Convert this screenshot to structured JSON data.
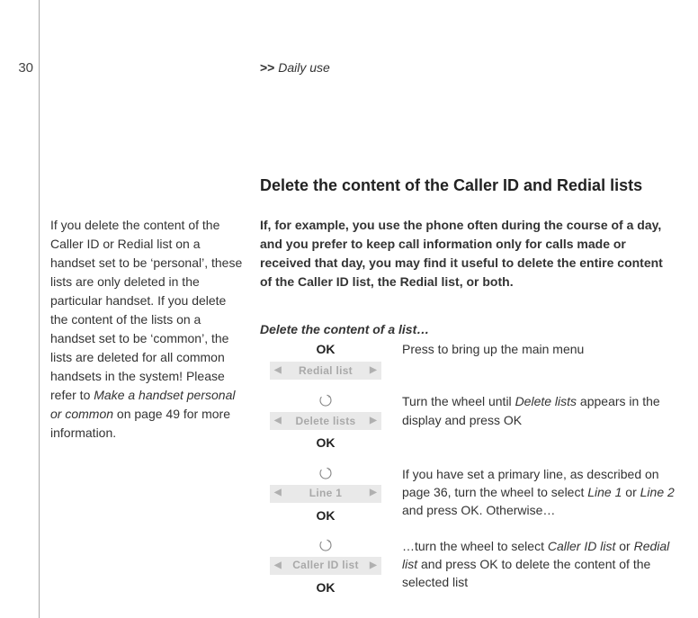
{
  "page_number": "30",
  "running_head": {
    "chev": ">>",
    "title": "Daily use"
  },
  "heading": "Delete the content of the Caller ID and Redial lists",
  "side_note": {
    "part1": "If you delete the content of the Caller ID or Redial list on a handset set to be ‘personal’, these lists are only deleted in the particular handset. If you delete the content of the lists on a handset set to be ‘common’, the lists are deleted for all common handsets in the system! Please refer to ",
    "em": "Make a handset personal or common",
    "part2": " on page 49 for more information."
  },
  "intro": "If, for example, you use the phone often during the course of a day, and you prefer to keep call information only for calls made or received that day, you may find it useful to delete the entire content of the Caller ID list, the Redial list, or both.",
  "subhead": "Delete the content of a list…",
  "ok_label": "OK",
  "steps": [
    {
      "buttons": [
        {
          "type": "ok"
        },
        {
          "type": "pill",
          "label": "Redial list"
        }
      ],
      "desc_parts": [
        {
          "t": "text",
          "v": "Press to bring up the main menu"
        }
      ]
    },
    {
      "buttons": [
        {
          "type": "wheel"
        },
        {
          "type": "pill",
          "label": "Delete lists"
        },
        {
          "type": "ok"
        }
      ],
      "desc_parts": [
        {
          "t": "text",
          "v": "Turn the wheel until "
        },
        {
          "t": "em",
          "v": "Delete lists"
        },
        {
          "t": "text",
          "v": " appears in the display and press OK"
        }
      ]
    },
    {
      "buttons": [
        {
          "type": "wheel"
        },
        {
          "type": "pill",
          "label": "Line 1"
        },
        {
          "type": "ok"
        }
      ],
      "desc_parts": [
        {
          "t": "text",
          "v": "If you have set a primary line, as described on page 36, turn the wheel to select "
        },
        {
          "t": "em",
          "v": "Line 1"
        },
        {
          "t": "text",
          "v": " or "
        },
        {
          "t": "em",
          "v": "Line 2"
        },
        {
          "t": "text",
          "v": " and press OK. Otherwise…"
        }
      ]
    },
    {
      "buttons": [
        {
          "type": "wheel"
        },
        {
          "type": "pill",
          "label": "Caller ID list"
        },
        {
          "type": "ok"
        }
      ],
      "desc_parts": [
        {
          "t": "text",
          "v": "…turn the wheel to select "
        },
        {
          "t": "em",
          "v": "Caller ID list"
        },
        {
          "t": "text",
          "v": " or "
        },
        {
          "t": "em",
          "v": "Redial list"
        },
        {
          "t": "text",
          "v": " and press OK to delete the content of the selected list"
        }
      ]
    }
  ]
}
